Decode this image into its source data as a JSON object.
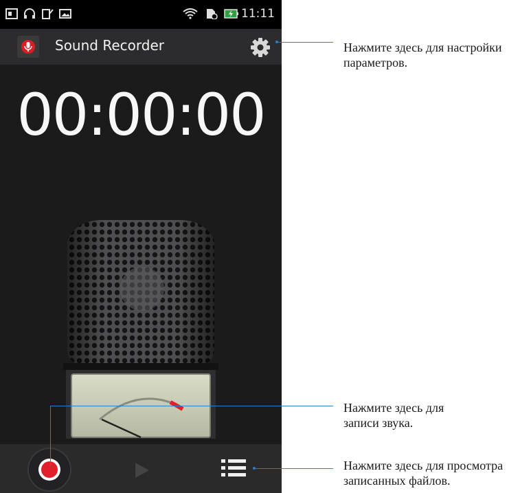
{
  "status_bar": {
    "time": "11:11",
    "icons": [
      "photo-icon",
      "headphones-icon",
      "sim-icon",
      "gallery-icon",
      "wifi-icon",
      "no-sim-icon",
      "battery-charging-icon"
    ]
  },
  "app_bar": {
    "title": "Sound Recorder",
    "logo_icon": "microphone-app-icon",
    "settings_icon": "gear-icon"
  },
  "timer": {
    "value": "00:00:00"
  },
  "bottom_bar": {
    "record_icon": "record-icon",
    "play_icon": "play-icon",
    "list_icon": "list-icon"
  },
  "callouts": {
    "settings_line1": "Нажмите здесь для настройки",
    "settings_line2": "параметров.",
    "record_line1": "Нажмите здесь для",
    "record_line2": "записи звука.",
    "files_line1": "Нажмите здесь для просмотра",
    "files_line2": "записанных файлов."
  },
  "colors": {
    "accent_red": "#e0202a",
    "callout_line": "#2f7cc0",
    "background": "#1b1b1c"
  }
}
